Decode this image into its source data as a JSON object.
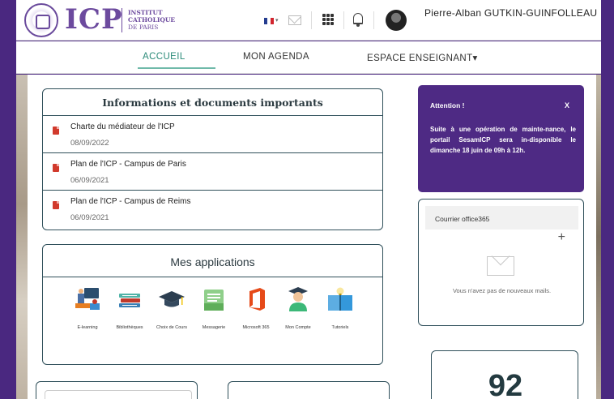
{
  "header": {
    "logo_text": "ICP",
    "logo_sub": [
      "INSTITUT",
      "CATHOLIQUE",
      "DE PARIS"
    ],
    "user_name": "Pierre-Alban GUTKIN-GUINFOLLEAU",
    "language_flag": "fr"
  },
  "nav": {
    "items": [
      "ACCUEIL",
      "MON AGENDA",
      "ESPACE ENSEIGNANT▾"
    ],
    "active": "ACCUEIL"
  },
  "info": {
    "title": "Informations et documents importants",
    "documents": [
      {
        "title": "Charte du médiateur de l'ICP",
        "date": "08/09/2022"
      },
      {
        "title": "Plan de l'ICP - Campus de Paris",
        "date": "06/09/2021"
      },
      {
        "title": "Plan de l'ICP - Campus de Reims",
        "date": "06/09/2021"
      }
    ]
  },
  "apps": {
    "title": "Mes applications",
    "items": [
      {
        "label": "E-learning",
        "icon": "e-learning-icon"
      },
      {
        "label": "Bibliothèques",
        "icon": "books-icon"
      },
      {
        "label": "Choix de Cours",
        "icon": "graduation-cap-icon"
      },
      {
        "label": "Messagerie",
        "icon": "mail-icon"
      },
      {
        "label": "Microsoft 365",
        "icon": "office-icon"
      },
      {
        "label": "Mon Compte",
        "icon": "graduate-user-icon"
      },
      {
        "label": "Tutoriels",
        "icon": "book-lightbulb-icon"
      }
    ]
  },
  "alert": {
    "title": "Attention !",
    "close": "X",
    "body": "Suite à une opération de mainte-nance, le portail SesamICP sera in-disponible le dimanche 18 juin de 09h à 12h."
  },
  "mail": {
    "title": "Courrier office365",
    "plus": "+",
    "empty": "Vous n'avez pas de nouveaux mails."
  },
  "counter": {
    "value": "92"
  },
  "colors": {
    "brand_purple": "#4e2a84",
    "accent_teal": "#2a8a78",
    "pdf_red": "#d13a2c",
    "office_orange": "#e64a19"
  }
}
